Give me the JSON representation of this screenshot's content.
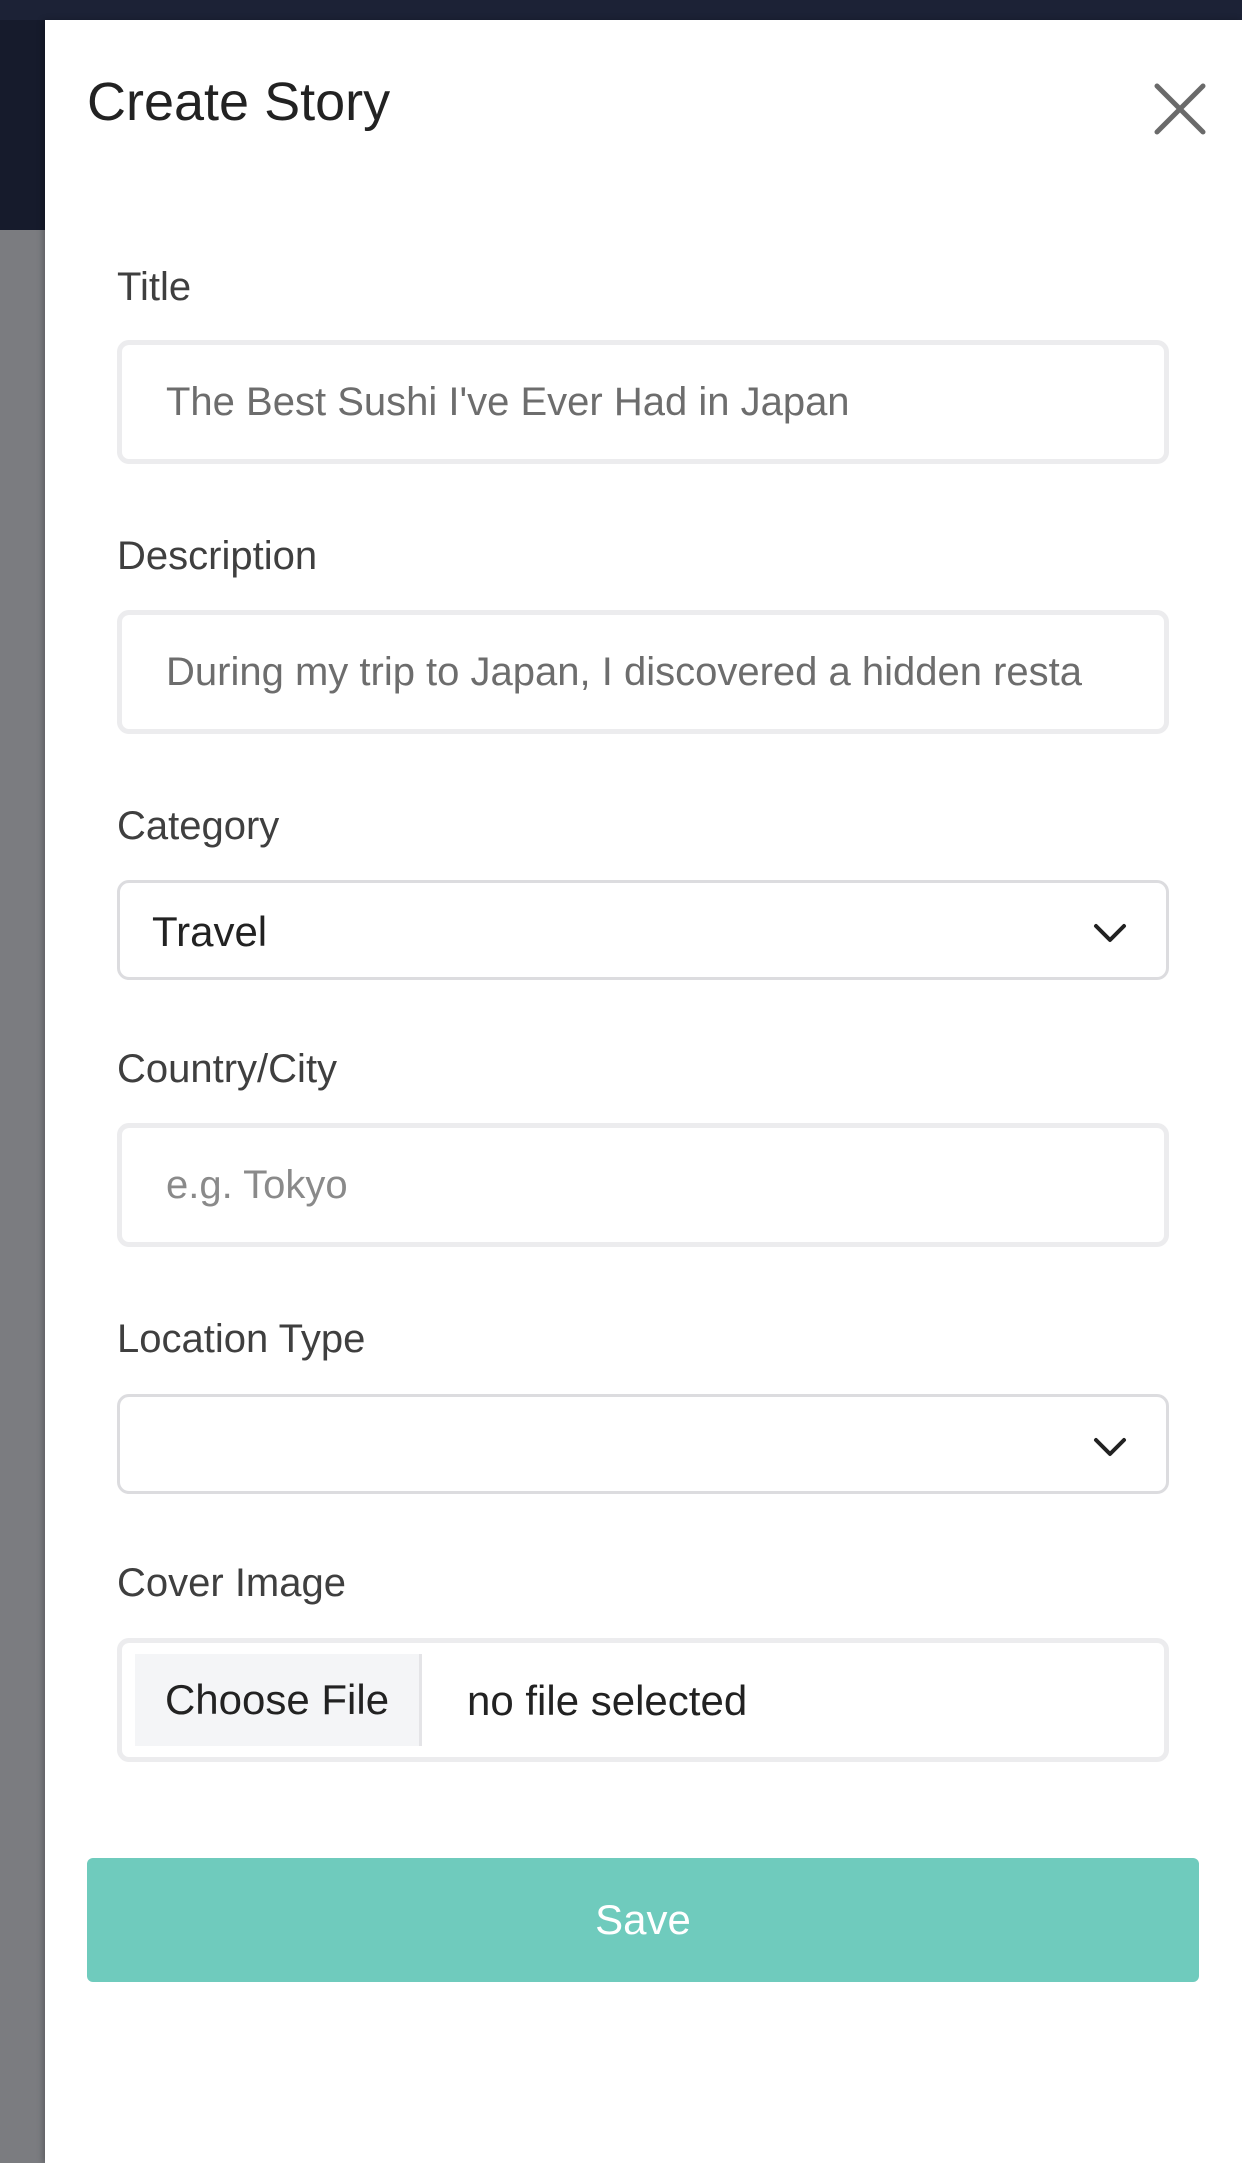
{
  "drawer": {
    "title": "Create Story"
  },
  "form": {
    "title": {
      "label": "Title",
      "value": "The Best Sushi I've Ever Had in Japan"
    },
    "description": {
      "label": "Description",
      "value": "During my trip to Japan, I discovered a hidden resta"
    },
    "category": {
      "label": "Category",
      "selected": "Travel"
    },
    "country_city": {
      "label": "Country/City",
      "placeholder": "e.g. Tokyo"
    },
    "location_type": {
      "label": "Location Type",
      "selected": ""
    },
    "cover_image": {
      "label": "Cover Image",
      "button_label": "Choose File",
      "status": "no file selected"
    },
    "save_label": "Save"
  },
  "icons": {
    "close": "close-icon",
    "dropdown": "chevron-down-icon"
  },
  "colors": {
    "accent": "#6fcbbd",
    "backdrop": "#7b7c80",
    "header_dark": "#161b2c"
  }
}
